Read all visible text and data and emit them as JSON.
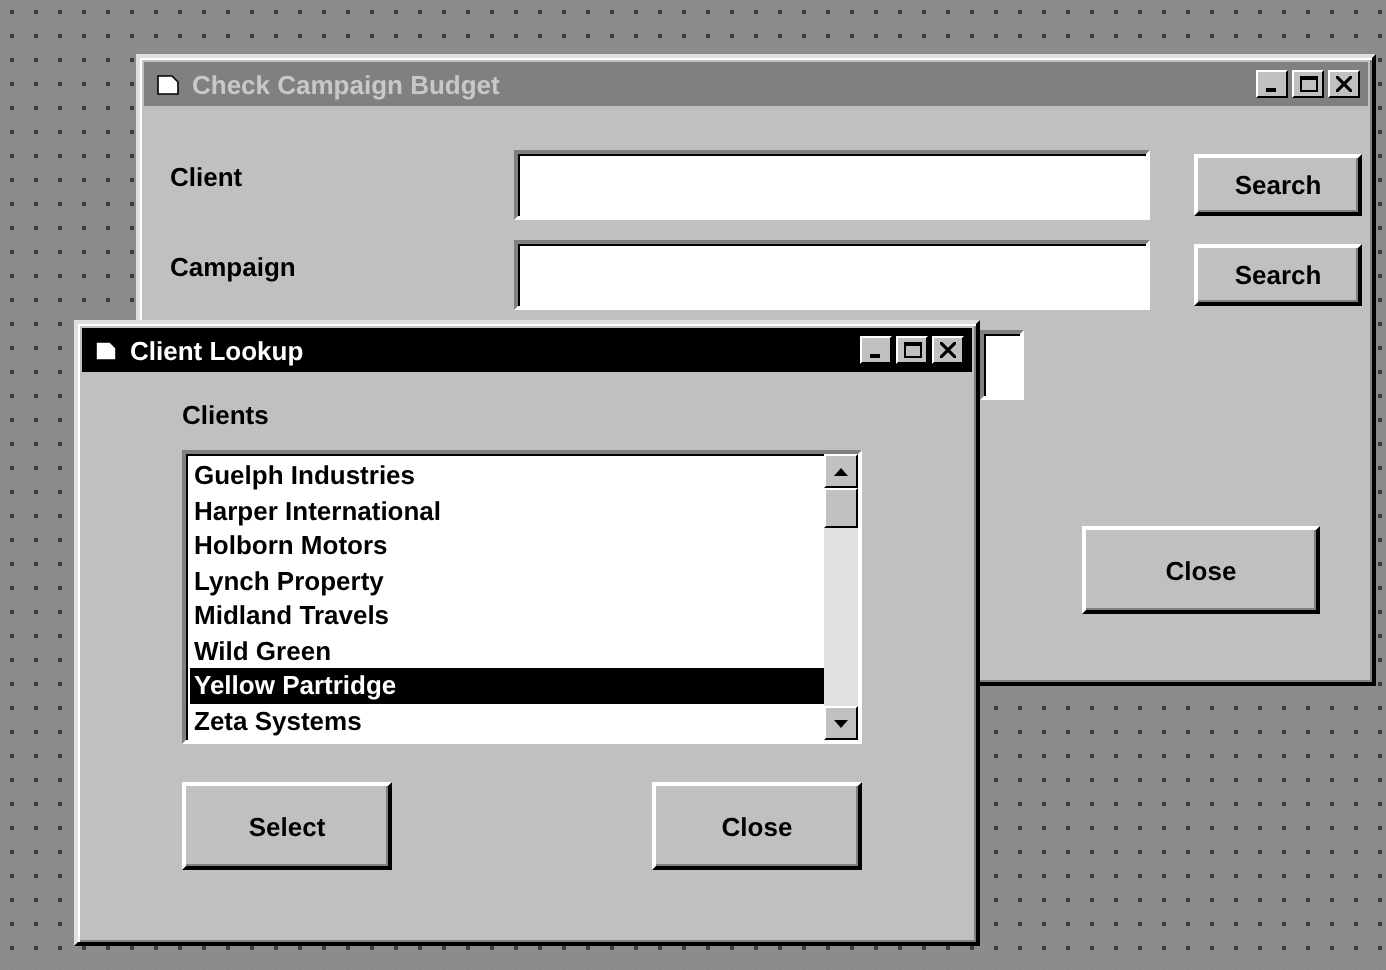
{
  "windows": [
    {
      "title": "Check Campaign Budget",
      "active": false,
      "kind": "budget",
      "fields": [
        {
          "label": "Client",
          "button": "Search"
        },
        {
          "label": "Campaign",
          "button": "Search"
        },
        {
          "kind": "hidden"
        }
      ],
      "buttons": [
        "Close"
      ]
    },
    {
      "title": "Client Lookup",
      "active": true,
      "kind": "lookup",
      "list_label": "Clients",
      "items": [
        {
          "label": "Guelph Industries",
          "selected": false
        },
        {
          "label": "Harper International",
          "selected": false
        },
        {
          "label": "Holborn Motors",
          "selected": false
        },
        {
          "label": "Lynch Property",
          "selected": false
        },
        {
          "label": "Midland Travels",
          "selected": false
        },
        {
          "label": "Wild Green",
          "selected": false
        },
        {
          "label": "Yellow Partridge",
          "selected": true
        },
        {
          "label": "Zeta Systems",
          "selected": false
        }
      ],
      "buttons": [
        "Select",
        "Close"
      ]
    }
  ]
}
